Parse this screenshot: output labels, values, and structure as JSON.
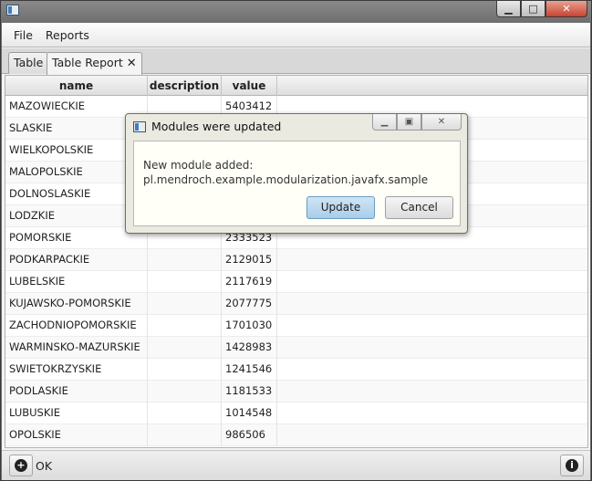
{
  "window": {
    "icon": "java-window-icon"
  },
  "menubar": {
    "items": [
      "File",
      "Reports"
    ]
  },
  "tabs": [
    {
      "label": "Table"
    },
    {
      "label": "Table Report",
      "close_glyph": "✕"
    }
  ],
  "table": {
    "columns": [
      "name",
      "description",
      "value"
    ],
    "rows": [
      {
        "name": "MAZOWIECKIE",
        "description": "",
        "value": "5403412"
      },
      {
        "name": "SLASKIE",
        "description": "",
        "value": ""
      },
      {
        "name": "WIELKOPOLSKIE",
        "description": "",
        "value": ""
      },
      {
        "name": "MALOPOLSKIE",
        "description": "",
        "value": ""
      },
      {
        "name": "DOLNOSLASKIE",
        "description": "",
        "value": ""
      },
      {
        "name": "LODZKIE",
        "description": "",
        "value": ""
      },
      {
        "name": "POMORSKIE",
        "description": "",
        "value": "2333523"
      },
      {
        "name": "PODKARPACKIE",
        "description": "",
        "value": "2129015"
      },
      {
        "name": "LUBELSKIE",
        "description": "",
        "value": "2117619"
      },
      {
        "name": "KUJAWSKO-POMORSKIE",
        "description": "",
        "value": "2077775"
      },
      {
        "name": "ZACHODNIOPOMORSKIE",
        "description": "",
        "value": "1701030"
      },
      {
        "name": "WARMINSKO-MAZURSKIE",
        "description": "",
        "value": "1428983"
      },
      {
        "name": "SWIETOKRZYSKIE",
        "description": "",
        "value": "1241546"
      },
      {
        "name": "PODLASKIE",
        "description": "",
        "value": "1181533"
      },
      {
        "name": "LUBUSKIE",
        "description": "",
        "value": "1014548"
      },
      {
        "name": "OPOLSKIE",
        "description": "",
        "value": "986506"
      }
    ]
  },
  "statusbar": {
    "ok_label": "OK",
    "add_glyph": "+",
    "info_glyph": "i"
  },
  "dialog": {
    "title": "Modules were updated",
    "message_line1": "New module added:",
    "message_line2": "pl.mendroch.example.modularization.javafx.sample",
    "update_label": "Update",
    "cancel_label": "Cancel"
  }
}
